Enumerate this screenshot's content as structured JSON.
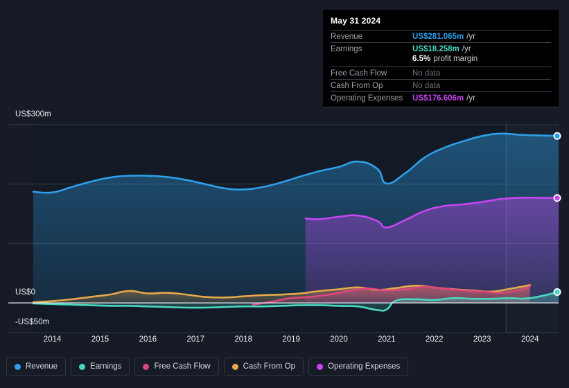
{
  "background_color": "#161b26",
  "tooltip": {
    "date": "May 31 2024",
    "rows": [
      {
        "label": "Revenue",
        "value": "US$281.065m",
        "suffix": "/yr",
        "color": "#2e9fe8",
        "muted": false
      },
      {
        "label": "Earnings",
        "value": "US$18.258m",
        "suffix": "/yr",
        "color": "#4ad8c0",
        "muted": false
      },
      {
        "label": "",
        "value": "6.5%",
        "suffix": "profit margin",
        "color": "#ffffff",
        "muted": false
      },
      {
        "label": "Free Cash Flow",
        "value": "No data",
        "suffix": "",
        "color": "#6b7177",
        "muted": true
      },
      {
        "label": "Cash From Op",
        "value": "No data",
        "suffix": "",
        "color": "#6b7177",
        "muted": true
      },
      {
        "label": "Operating Expenses",
        "value": "US$176.606m",
        "suffix": "/yr",
        "color": "#c646f0",
        "muted": false
      }
    ]
  },
  "legend": {
    "items": [
      {
        "label": "Revenue",
        "color": "#2e9fe8"
      },
      {
        "label": "Earnings",
        "color": "#4ad8c0"
      },
      {
        "label": "Free Cash Flow",
        "color": "#e0457f"
      },
      {
        "label": "Cash From Op",
        "color": "#e8a94a"
      },
      {
        "label": "Operating Expenses",
        "color": "#c646f0"
      }
    ]
  },
  "chart_data": {
    "type": "area",
    "title": "",
    "xlabel": "",
    "ylabel": "",
    "currency": "US$",
    "units": "m",
    "grid": true,
    "legend_position": "bottom-left",
    "ylim": [
      -50,
      300
    ],
    "y_ticks": [
      {
        "value": 300,
        "label": "US$300m"
      },
      {
        "value": 200,
        "label": ""
      },
      {
        "value": 100,
        "label": ""
      },
      {
        "value": 0,
        "label": "US$0"
      },
      {
        "value": -50,
        "label": "-US$50m"
      }
    ],
    "x_ticks": [
      "2014",
      "2015",
      "2016",
      "2017",
      "2018",
      "2019",
      "2020",
      "2021",
      "2022",
      "2023",
      "2024"
    ],
    "xlim": [
      2013.6,
      2024.6
    ],
    "forecast_boundary_year": 2023.5,
    "series": [
      {
        "name": "Revenue",
        "color": "#2e9fe8",
        "fill": true,
        "x": [
          2013.6,
          2014.0,
          2014.4,
          2014.8,
          2015.2,
          2015.6,
          2016.0,
          2016.4,
          2016.8,
          2017.2,
          2017.6,
          2018.0,
          2018.4,
          2018.8,
          2019.2,
          2019.6,
          2020.0,
          2020.4,
          2020.8,
          2021.0,
          2021.4,
          2021.8,
          2022.2,
          2022.6,
          2023.0,
          2023.4,
          2023.8,
          2024.2,
          2024.6
        ],
        "values": [
          187,
          186,
          195,
          204,
          211,
          214,
          214,
          212,
          207,
          200,
          193,
          191,
          195,
          203,
          213,
          222,
          229,
          238,
          226,
          201,
          219,
          245,
          261,
          272,
          281,
          285,
          283,
          282,
          281.065
        ]
      },
      {
        "name": "Operating Expenses",
        "color": "#c646f0",
        "fill": true,
        "x": [
          2019.3,
          2019.6,
          2020.0,
          2020.4,
          2020.8,
          2021.0,
          2021.4,
          2021.8,
          2022.2,
          2022.6,
          2023.0,
          2023.4,
          2023.8,
          2024.2,
          2024.6
        ],
        "values": [
          142,
          141,
          145,
          147,
          138,
          127,
          140,
          155,
          163,
          166,
          170,
          175,
          177,
          177,
          176.606
        ]
      },
      {
        "name": "Cash From Op",
        "color": "#e8a94a",
        "fill": true,
        "x": [
          2013.6,
          2014.0,
          2014.4,
          2014.8,
          2015.2,
          2015.6,
          2016.0,
          2016.4,
          2016.8,
          2017.2,
          2017.6,
          2018.0,
          2018.4,
          2018.8,
          2019.2,
          2019.6,
          2020.0,
          2020.4,
          2020.8,
          2021.2,
          2021.6,
          2022.0,
          2022.4,
          2022.8,
          2023.2,
          2023.6,
          2024.0
        ],
        "values": [
          1,
          3,
          6,
          10,
          14,
          20,
          16,
          17,
          14,
          10,
          9,
          11,
          13,
          14,
          16,
          20,
          23,
          26,
          22,
          25,
          29,
          26,
          23,
          21,
          19,
          24,
          30
        ]
      },
      {
        "name": "Free Cash Flow",
        "color": "#e0457f",
        "fill": true,
        "x": [
          2018.2,
          2018.6,
          2019.0,
          2019.4,
          2019.8,
          2020.2,
          2020.6,
          2021.0,
          2021.4,
          2021.8,
          2022.2,
          2022.6,
          2023.0,
          2023.4,
          2023.8,
          2024.0
        ],
        "values": [
          -3,
          2,
          8,
          10,
          14,
          20,
          24,
          21,
          23,
          27,
          24,
          21,
          19,
          17,
          22,
          28
        ]
      },
      {
        "name": "Earnings",
        "color": "#4ad8c0",
        "fill": true,
        "x": [
          2013.6,
          2014.0,
          2014.4,
          2014.8,
          2015.2,
          2015.6,
          2016.0,
          2016.4,
          2016.8,
          2017.2,
          2017.6,
          2018.0,
          2018.4,
          2018.8,
          2019.2,
          2019.6,
          2020.0,
          2020.4,
          2020.8,
          2021.0,
          2021.2,
          2021.6,
          2022.0,
          2022.4,
          2022.8,
          2023.2,
          2023.6,
          2024.0,
          2024.6
        ],
        "values": [
          -1,
          -2,
          -3,
          -4,
          -5,
          -5,
          -6,
          -7,
          -8,
          -8,
          -7,
          -6,
          -6,
          -5,
          -4,
          -4,
          -5,
          -6,
          -12,
          -11,
          4,
          6,
          5,
          8,
          7,
          7,
          8,
          8,
          18.258
        ]
      }
    ],
    "end_markers": [
      {
        "series": "Revenue",
        "value": 281.065,
        "color": "#2e9fe8"
      },
      {
        "series": "Operating Expenses",
        "value": 176.606,
        "color": "#c646f0"
      },
      {
        "series": "Earnings",
        "value": 18.258,
        "color": "#4ad8c0"
      }
    ]
  }
}
